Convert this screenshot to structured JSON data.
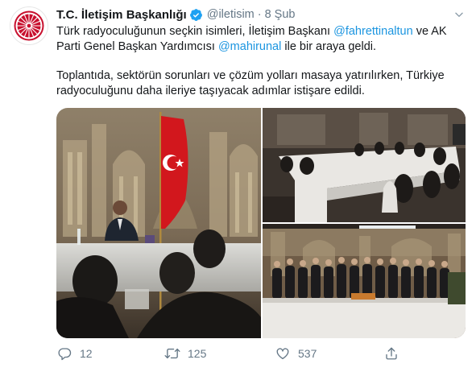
{
  "tweet": {
    "account_name": "T.C. İletişim Başkanlığı",
    "handle": "@iletisim",
    "separator": "·",
    "date": "8 Şub",
    "paragraph1": {
      "part1": "Türk radyoculuğunun seçkin isimleri, İletişim Başkanı ",
      "mention1": "@fahrettinaltun",
      "part2": " ve AK Parti Genel Başkan Yardımcısı ",
      "mention2": "@mahirunal",
      "part3": " ile bir araya geldi."
    },
    "paragraph2": "Toplantıda, sektörün sorunları ve çözüm yolları masaya yatırılırken, Türkiye radyoculuğunu daha ileriye taşıyacak adımlar istişare edildi."
  },
  "actions": {
    "replies": "12",
    "retweets": "125",
    "likes": "537"
  },
  "icons": {
    "verified": "verified-badge-icon",
    "caret": "chevron-down-icon",
    "reply": "reply-icon",
    "retweet": "retweet-icon",
    "like": "heart-icon",
    "share": "share-icon"
  },
  "colors": {
    "text": "#14171a",
    "secondary": "#657786",
    "link": "#1b95e0",
    "verified": "#1da1f2",
    "logo_red": "#c8102e"
  }
}
